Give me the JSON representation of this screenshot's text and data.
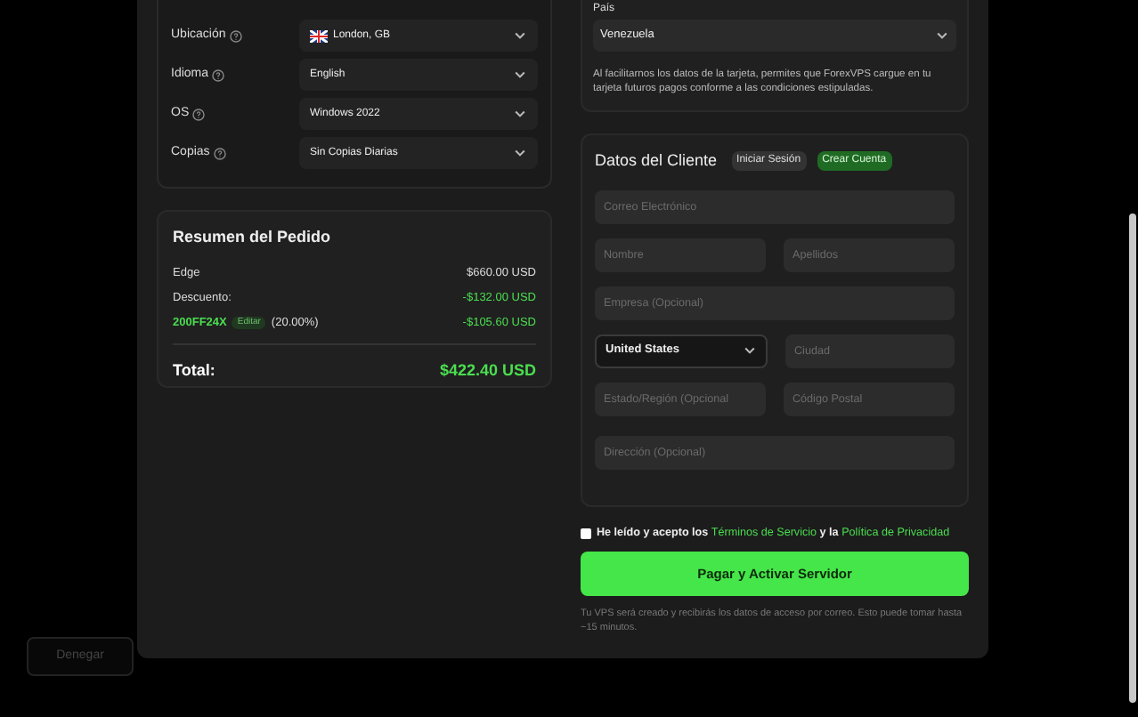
{
  "background": {
    "button": "Denegar"
  },
  "config": {
    "rows": [
      {
        "label": "Ubicación",
        "value": "London, GB",
        "flag": true
      },
      {
        "label": "Idioma",
        "value": "English",
        "flag": false
      },
      {
        "label": "OS",
        "value": "Windows 2022",
        "flag": false
      },
      {
        "label": "Copias",
        "value": "Sin Copias Diarias",
        "flag": false
      }
    ]
  },
  "summary": {
    "title": "Resumen del Pedido",
    "lines": [
      {
        "label": "Edge",
        "amount": "$660.00 USD",
        "kind": "plain"
      },
      {
        "label": "Descuento:",
        "amount": "-$132.00 USD",
        "kind": "discount"
      },
      {
        "label": "200FF24X",
        "edit": "Editar",
        "percent": "(20.00%)",
        "amount": "-$105.60 USD",
        "kind": "coupon"
      }
    ],
    "total_label": "Total:",
    "total": "$422.40 USD"
  },
  "payment": {
    "country_label": "País",
    "country": "Venezuela",
    "note": "Al facilitarnos los datos de la tarjeta, permites que ForexVPS cargue en tu tarjeta futuros pagos conforme a las condiciones estipuladas."
  },
  "customer": {
    "title": "Datos del Cliente",
    "tabs": [
      {
        "label": "Iniciar Sesión",
        "selected": false
      },
      {
        "label": "Crear Cuenta",
        "selected": true
      }
    ],
    "fields": [
      [
        {
          "placeholder": "Correo Electrónico",
          "kind": "input"
        }
      ],
      [
        {
          "placeholder": "Nombre",
          "kind": "input"
        },
        {
          "placeholder": "Apellidos",
          "kind": "input"
        }
      ],
      [
        {
          "placeholder": "Empresa (Opcional)",
          "kind": "input"
        }
      ],
      [
        {
          "value": "United States",
          "kind": "select"
        },
        {
          "placeholder": "Ciudad",
          "kind": "input"
        }
      ],
      [
        {
          "placeholder": "Estado/Región (Opcional",
          "kind": "input"
        },
        {
          "placeholder": "Código Postal",
          "kind": "input"
        }
      ],
      [
        {
          "placeholder": "Dirección (Opcional)",
          "kind": "input"
        }
      ]
    ]
  },
  "terms": {
    "checked": false,
    "text_before": "He leído y acepto los",
    "link1": "Términos de Servicio",
    "middle": "y la",
    "link2": "Política de Privacidad"
  },
  "submit": "Pagar y Activar Servidor",
  "footnote": "Tu VPS será creado y recibirás los datos de acceso por correo. Esto puede tomar hasta ~15 minutos."
}
